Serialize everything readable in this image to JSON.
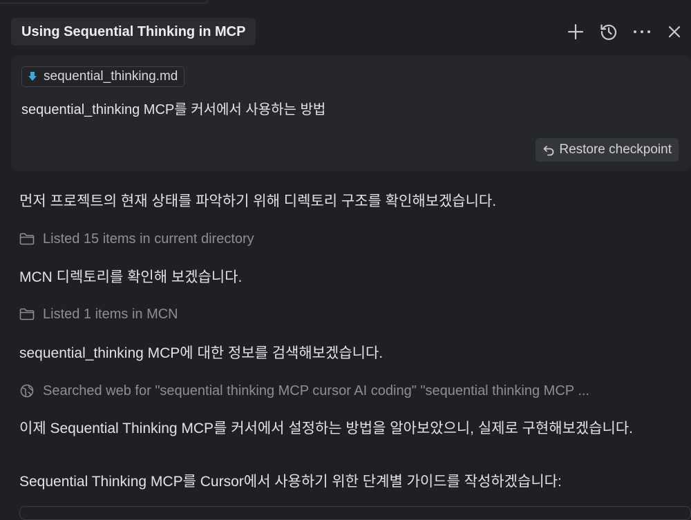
{
  "header": {
    "tab_title": "Using Sequential Thinking in MCP",
    "icons": [
      "plus-icon",
      "history-icon",
      "more-icon",
      "close-icon"
    ]
  },
  "user_card": {
    "file_chip": "sequential_thinking.md",
    "message": "sequential_thinking MCP를 커서에서 사용하는 방법",
    "restore_label": "Restore checkpoint"
  },
  "conversation": {
    "msg1": "먼저 프로젝트의 현재 상태를 파악하기 위해 디렉토리 구조를 확인해보겠습니다.",
    "tool1": "Listed 15 items in current directory",
    "msg2": "MCN 디렉토리를 확인해 보겠습니다.",
    "tool2": "Listed 1 items in MCN",
    "msg3": "sequential_thinking MCP에 대한 정보를 검색해보겠습니다.",
    "tool3": "Searched web for \"sequential thinking MCP cursor AI coding\" \"sequential thinking MCP ...",
    "msg4": "이제 Sequential Thinking MCP를 커서에서 설정하는 방법을 알아보았으니, 실제로 구현해보겠습니다.",
    "msg5": "Sequential Thinking MCP를 Cursor에서 사용하기 위한 단계별 가이드를 작성하겠습니다:"
  },
  "colors": {
    "background": "#1e2023",
    "card": "#25272b",
    "file_icon_accent": "#3fa9d8",
    "muted_text": "#8c8f95"
  }
}
